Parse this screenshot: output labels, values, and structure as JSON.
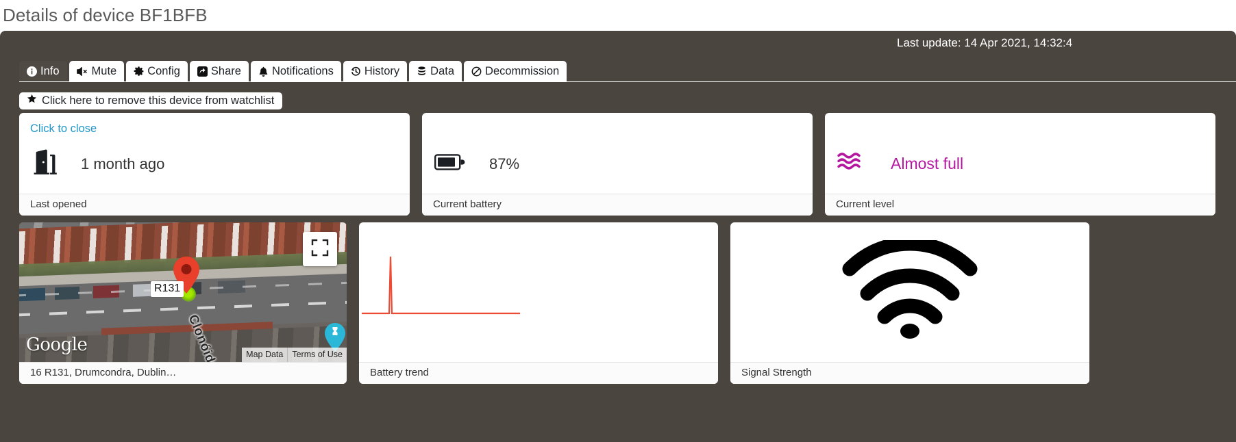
{
  "page": {
    "title": "Details of device BF1BFB",
    "last_update_label": "Last update: 14 Apr 2021, 14:32:4"
  },
  "tabs": [
    {
      "label": "Info",
      "icon": "info-circle-icon",
      "active": true
    },
    {
      "label": "Mute",
      "icon": "volume-mute-icon",
      "active": false
    },
    {
      "label": "Config",
      "icon": "gear-icon",
      "active": false
    },
    {
      "label": "Share",
      "icon": "share-icon",
      "active": false
    },
    {
      "label": "Notifications",
      "icon": "bell-icon",
      "active": false
    },
    {
      "label": "History",
      "icon": "clock-history-icon",
      "active": false
    },
    {
      "label": "Data",
      "icon": "database-icon",
      "active": false
    },
    {
      "label": "Decommission",
      "icon": "slash-circle-icon",
      "active": false
    }
  ],
  "watchlist": {
    "label": "Click here to remove this device from watchlist",
    "icon": "star-filled-icon"
  },
  "cards": {
    "last_opened": {
      "link_label": "Click to close",
      "icon": "door-open-icon",
      "value": "1 month ago",
      "footer": "Last opened"
    },
    "battery": {
      "icon": "battery-icon",
      "value": "87%",
      "footer": "Current battery",
      "fill_percent": 75
    },
    "level": {
      "icon": "water-waves-icon",
      "value": "Almost full",
      "footer": "Current level",
      "color": "#b5169f"
    },
    "map": {
      "footer": "16 R131, Drumcondra, Dublin…",
      "marker_label": "R131",
      "street_label": "Clonóide",
      "attribution_logo": "Google",
      "terms": [
        "Map Data",
        "Terms of Use"
      ],
      "fullscreen_icon": "fullscreen-icon",
      "pin_icon": "map-pin-icon"
    },
    "battery_trend": {
      "footer": "Battery trend",
      "line_color": "#ee4b34"
    },
    "signal": {
      "footer": "Signal Strength",
      "icon": "wifi-icon"
    }
  },
  "chart_data": {
    "type": "line",
    "title": "Battery trend",
    "xlabel": "",
    "ylabel": "",
    "line_color": "#ee4b34",
    "x": [
      0,
      1,
      2,
      3,
      4,
      5,
      6,
      7,
      8,
      9,
      10,
      11,
      12,
      13,
      14,
      15,
      16,
      17,
      18,
      19,
      20,
      21,
      22,
      23
    ],
    "values": [
      2,
      2,
      2,
      100,
      2,
      2,
      2,
      2,
      2,
      2,
      2,
      2,
      2,
      2,
      2,
      2,
      2,
      2,
      2,
      2,
      2,
      2,
      2,
      2
    ],
    "ylim": [
      0,
      100
    ],
    "grid": false,
    "legend": false
  },
  "theme": {
    "panel_bg": "#4b4540",
    "card_bg": "#ffffff",
    "link_color": "#2196c9",
    "accent_magenta": "#b5169f",
    "title_color": "#5a5a5a"
  }
}
